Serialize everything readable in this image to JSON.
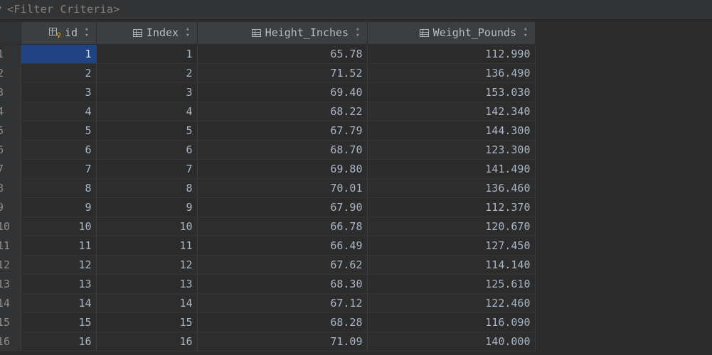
{
  "filter": {
    "text": "<Filter Criteria>"
  },
  "columns": [
    {
      "label": "id",
      "icon": "primary-key-column-icon"
    },
    {
      "label": "Index",
      "icon": "column-icon"
    },
    {
      "label": "Height_Inches",
      "icon": "column-icon"
    },
    {
      "label": "Weight_Pounds",
      "icon": "column-icon"
    }
  ],
  "rows": [
    {
      "n": "1",
      "id": "1",
      "index": "1",
      "height": "65.78",
      "weight": "112.990"
    },
    {
      "n": "2",
      "id": "2",
      "index": "2",
      "height": "71.52",
      "weight": "136.490"
    },
    {
      "n": "3",
      "id": "3",
      "index": "3",
      "height": "69.40",
      "weight": "153.030"
    },
    {
      "n": "4",
      "id": "4",
      "index": "4",
      "height": "68.22",
      "weight": "142.340"
    },
    {
      "n": "5",
      "id": "5",
      "index": "5",
      "height": "67.79",
      "weight": "144.300"
    },
    {
      "n": "6",
      "id": "6",
      "index": "6",
      "height": "68.70",
      "weight": "123.300"
    },
    {
      "n": "7",
      "id": "7",
      "index": "7",
      "height": "69.80",
      "weight": "141.490"
    },
    {
      "n": "8",
      "id": "8",
      "index": "8",
      "height": "70.01",
      "weight": "136.460"
    },
    {
      "n": "9",
      "id": "9",
      "index": "9",
      "height": "67.90",
      "weight": "112.370"
    },
    {
      "n": "10",
      "id": "10",
      "index": "10",
      "height": "66.78",
      "weight": "120.670"
    },
    {
      "n": "11",
      "id": "11",
      "index": "11",
      "height": "66.49",
      "weight": "127.450"
    },
    {
      "n": "12",
      "id": "12",
      "index": "12",
      "height": "67.62",
      "weight": "114.140"
    },
    {
      "n": "13",
      "id": "13",
      "index": "13",
      "height": "68.30",
      "weight": "125.610"
    },
    {
      "n": "14",
      "id": "14",
      "index": "14",
      "height": "67.12",
      "weight": "122.460"
    },
    {
      "n": "15",
      "id": "15",
      "index": "15",
      "height": "68.28",
      "weight": "116.090"
    },
    {
      "n": "16",
      "id": "16",
      "index": "16",
      "height": "71.09",
      "weight": "140.000"
    }
  ],
  "selected_cell": {
    "row": 0,
    "column": "id"
  },
  "colors": {
    "background": "#2b2b2b",
    "header": "#3c3f41",
    "selection": "#214283",
    "key": "#e8b030"
  }
}
